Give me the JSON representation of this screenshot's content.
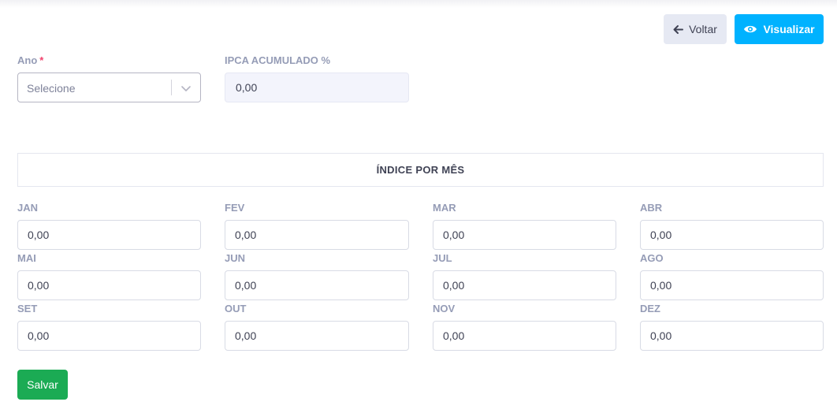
{
  "toolbar": {
    "back_label": "Voltar",
    "view_label": "Visualizar"
  },
  "form": {
    "ano_label": "Ano",
    "ano_required_mark": "*",
    "ano_placeholder": "Selecione",
    "ipca_label": "IPCA ACUMULADO %",
    "ipca_value": "0,00"
  },
  "section": {
    "title": "ÍNDICE POR MÊS"
  },
  "months": [
    {
      "label": "JAN",
      "value": "0,00"
    },
    {
      "label": "FEV",
      "value": "0,00"
    },
    {
      "label": "MAR",
      "value": "0,00"
    },
    {
      "label": "ABR",
      "value": "0,00"
    },
    {
      "label": "MAI",
      "value": "0,00"
    },
    {
      "label": "JUN",
      "value": "0,00"
    },
    {
      "label": "JUL",
      "value": "0,00"
    },
    {
      "label": "AGO",
      "value": "0,00"
    },
    {
      "label": "SET",
      "value": "0,00"
    },
    {
      "label": "OUT",
      "value": "0,00"
    },
    {
      "label": "NOV",
      "value": "0,00"
    },
    {
      "label": "DEZ",
      "value": "0,00"
    }
  ],
  "actions": {
    "save_label": "Salvar"
  },
  "icons": {
    "back": "arrow-left-icon",
    "view": "eye-icon",
    "select": "chevron-down-icon"
  },
  "colors": {
    "primary": "#00b2ff",
    "success": "#1bab54",
    "label": "#959cb6",
    "required": "#f1416c"
  }
}
